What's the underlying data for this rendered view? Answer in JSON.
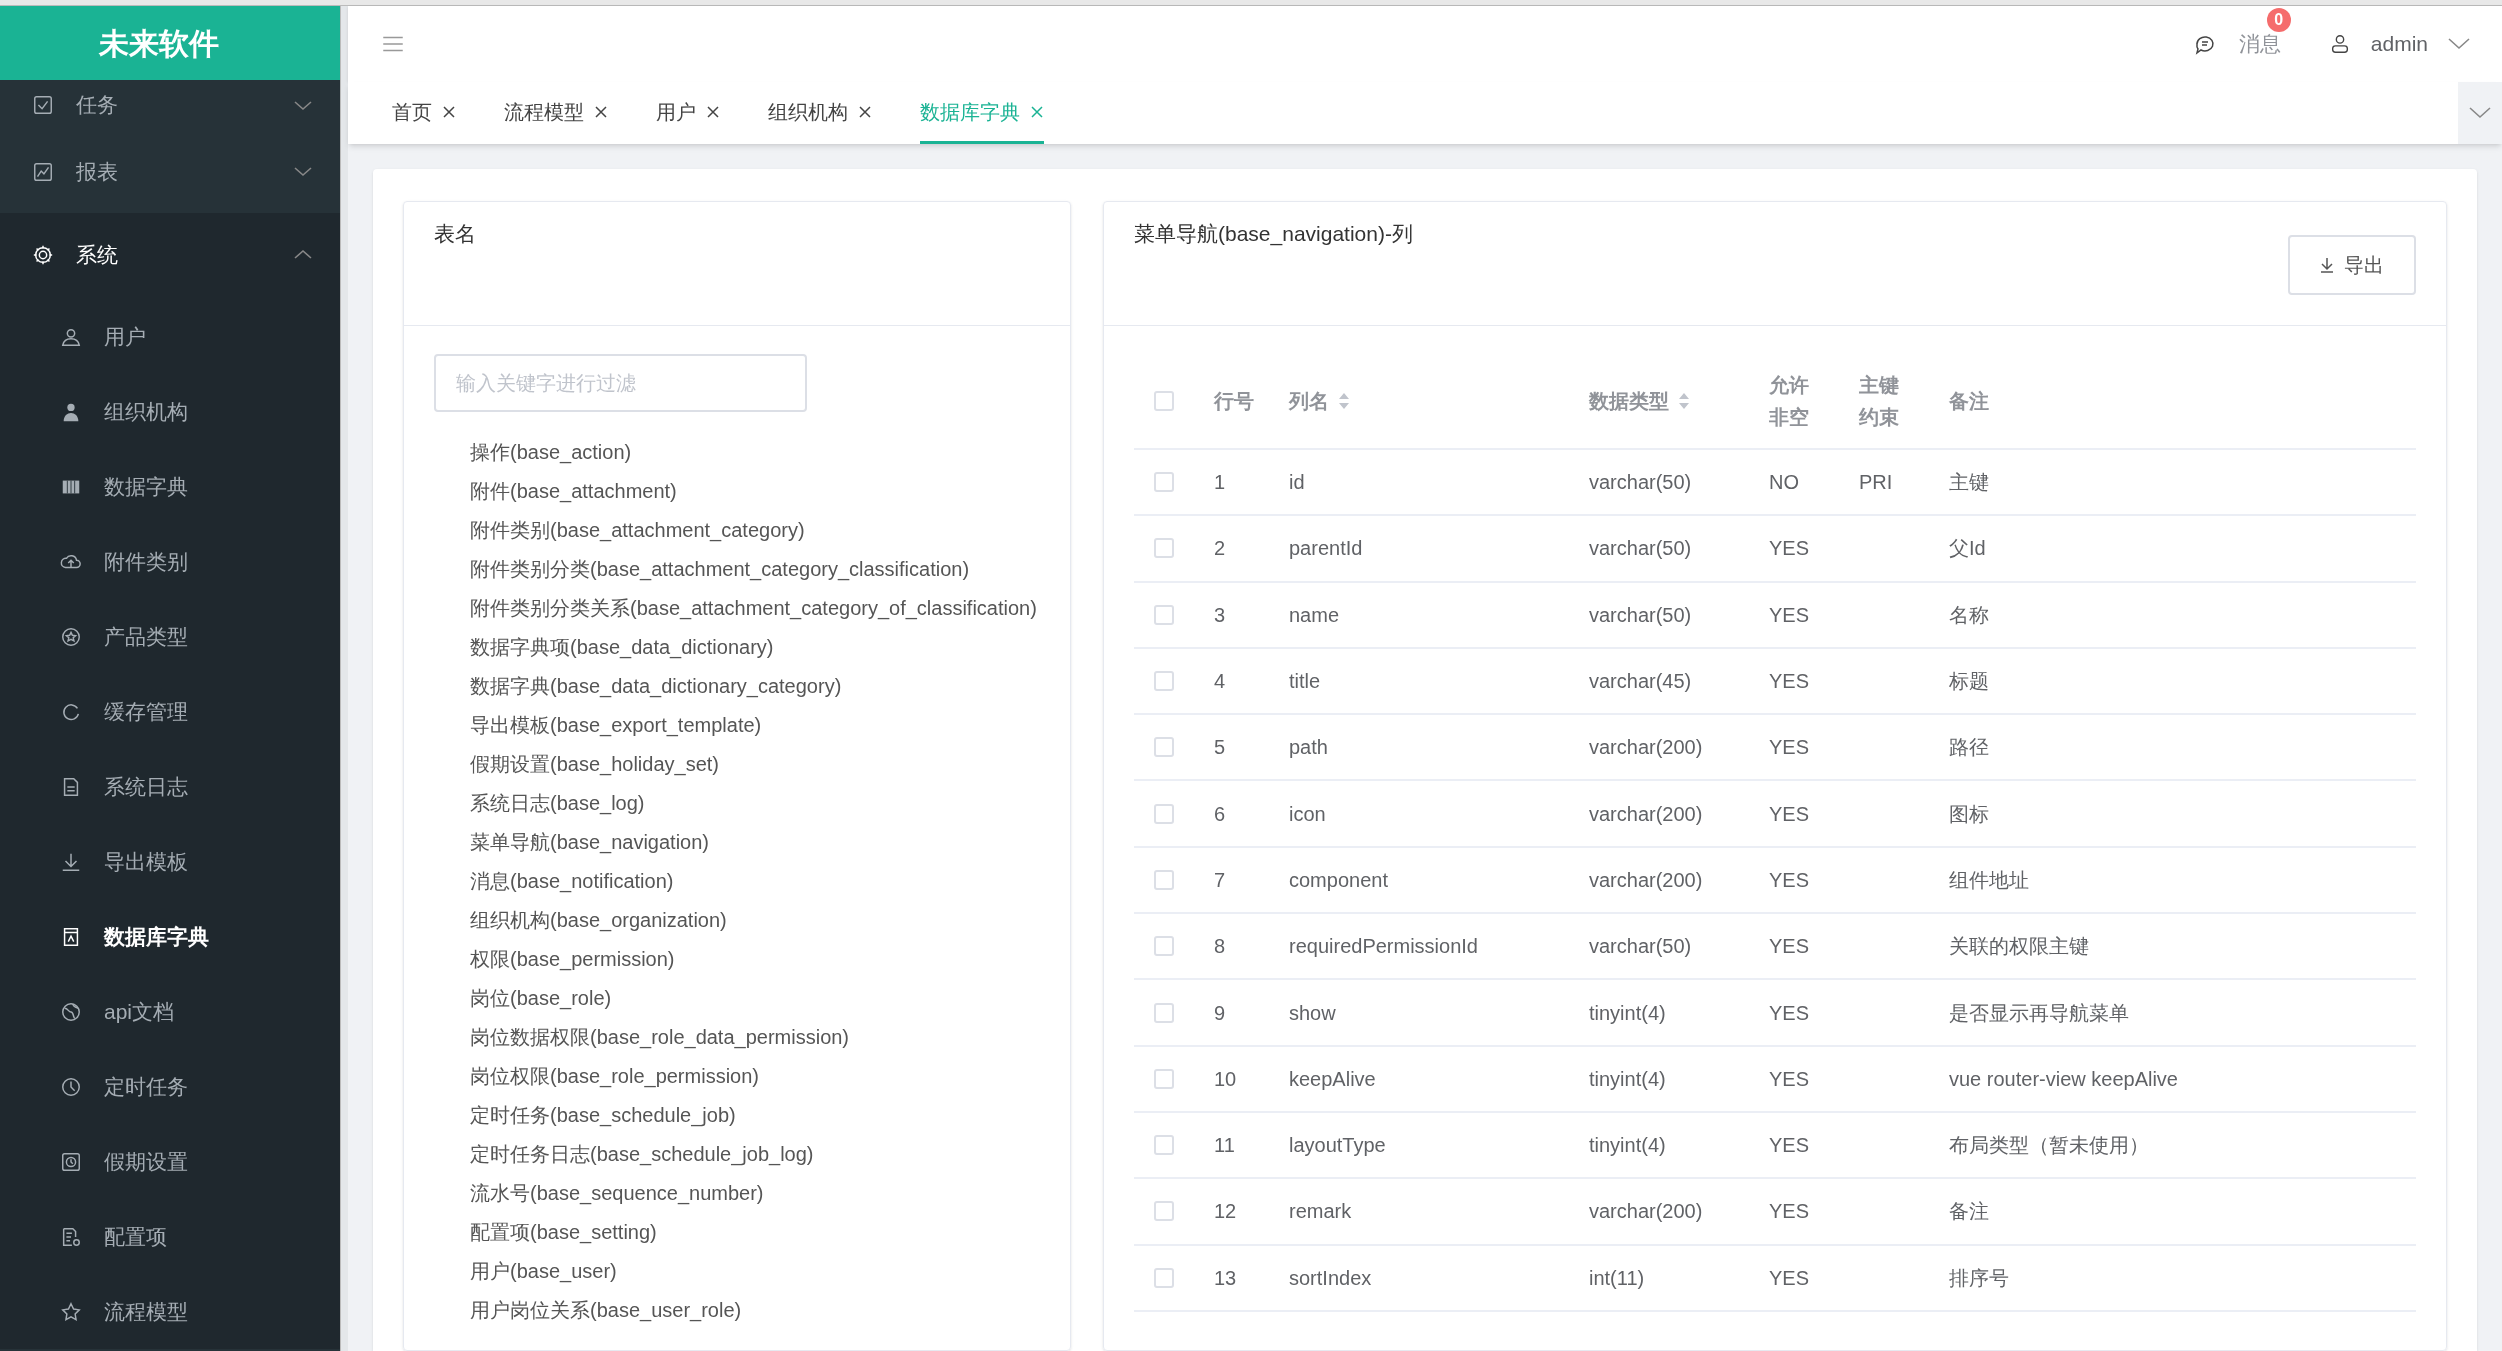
{
  "logo": "未来软件",
  "header": {
    "messages_label": "消息",
    "messages_count": "0",
    "user": "admin"
  },
  "sidebar": [
    {
      "kind": "group",
      "label": "任务",
      "expanded": false
    },
    {
      "kind": "group",
      "label": "报表",
      "expanded": false
    },
    {
      "kind": "group",
      "label": "系统",
      "expanded": true,
      "children": [
        {
          "label": "用户",
          "selected": false
        },
        {
          "label": "组织机构",
          "selected": false
        },
        {
          "label": "数据字典",
          "selected": false
        },
        {
          "label": "附件类别",
          "selected": false
        },
        {
          "label": "产品类型",
          "selected": false
        },
        {
          "label": "缓存管理",
          "selected": false
        },
        {
          "label": "系统日志",
          "selected": false
        },
        {
          "label": "导出模板",
          "selected": false
        },
        {
          "label": "数据库字典",
          "selected": true
        },
        {
          "label": "api文档",
          "selected": false
        },
        {
          "label": "定时任务",
          "selected": false
        },
        {
          "label": "假期设置",
          "selected": false
        },
        {
          "label": "配置项",
          "selected": false
        },
        {
          "label": "流程模型",
          "selected": false
        }
      ]
    }
  ],
  "tabs": [
    {
      "label": "首页",
      "selected": false
    },
    {
      "label": "流程模型",
      "selected": false
    },
    {
      "label": "用户",
      "selected": false
    },
    {
      "label": "组织机构",
      "selected": false
    },
    {
      "label": "数据库字典",
      "selected": true
    }
  ],
  "tables_panel": {
    "title": "表名",
    "filter": {
      "placeholder": "输入关键字进行过滤"
    },
    "tables": [
      "操作(base_action)",
      "附件(base_attachment)",
      "附件类别(base_attachment_category)",
      "附件类别分类(base_attachment_category_classification)",
      "附件类别分类关系(base_attachment_category_of_classification)",
      "数据字典项(base_data_dictionary)",
      "数据字典(base_data_dictionary_category)",
      "导出模板(base_export_template)",
      "假期设置(base_holiday_set)",
      "系统日志(base_log)",
      "菜单导航(base_navigation)",
      "消息(base_notification)",
      "组织机构(base_organization)",
      "权限(base_permission)",
      "岗位(base_role)",
      "岗位数据权限(base_role_data_permission)",
      "岗位权限(base_role_permission)",
      "定时任务(base_schedule_job)",
      "定时任务日志(base_schedule_job_log)",
      "流水号(base_sequence_number)",
      "配置项(base_setting)",
      "用户(base_user)",
      "用户岗位关系(base_user_role)"
    ]
  },
  "columns_panel": {
    "title": "菜单导航(base_navigation)-列",
    "export_button": "导出",
    "header_checked": false,
    "columns": [
      {
        "label": "行号",
        "sortable": false
      },
      {
        "label": "列名",
        "sortable": true
      },
      {
        "label": "数据类型",
        "sortable": true
      },
      {
        "label": "允许非空",
        "sortable": false
      },
      {
        "label": "主键约束",
        "sortable": false
      },
      {
        "label": "备注",
        "sortable": false
      }
    ],
    "rows": [
      {
        "checked": false,
        "cells": [
          "1",
          "id",
          "varchar(50)",
          "NO",
          "PRI",
          "主键"
        ]
      },
      {
        "checked": false,
        "cells": [
          "2",
          "parentId",
          "varchar(50)",
          "YES",
          "",
          "父Id"
        ]
      },
      {
        "checked": false,
        "cells": [
          "3",
          "name",
          "varchar(50)",
          "YES",
          "",
          "名称"
        ]
      },
      {
        "checked": false,
        "cells": [
          "4",
          "title",
          "varchar(45)",
          "YES",
          "",
          "标题"
        ]
      },
      {
        "checked": false,
        "cells": [
          "5",
          "path",
          "varchar(200)",
          "YES",
          "",
          "路径"
        ]
      },
      {
        "checked": false,
        "cells": [
          "6",
          "icon",
          "varchar(200)",
          "YES",
          "",
          "图标"
        ]
      },
      {
        "checked": false,
        "cells": [
          "7",
          "component",
          "varchar(200)",
          "YES",
          "",
          "组件地址"
        ]
      },
      {
        "checked": false,
        "cells": [
          "8",
          "requiredPermissionId",
          "varchar(50)",
          "YES",
          "",
          "关联的权限主键"
        ]
      },
      {
        "checked": false,
        "cells": [
          "9",
          "show",
          "tinyint(4)",
          "YES",
          "",
          "是否显示再导航菜单"
        ]
      },
      {
        "checked": false,
        "cells": [
          "10",
          "keepAlive",
          "tinyint(4)",
          "YES",
          "",
          "vue router-view keepAlive"
        ]
      },
      {
        "checked": false,
        "cells": [
          "11",
          "layoutType",
          "tinyint(4)",
          "YES",
          "",
          "布局类型（暂未使用）"
        ]
      },
      {
        "checked": false,
        "cells": [
          "12",
          "remark",
          "varchar(200)",
          "YES",
          "",
          "备注"
        ]
      },
      {
        "checked": false,
        "cells": [
          "13",
          "sortIndex",
          "int(11)",
          "YES",
          "",
          "排序号"
        ]
      }
    ]
  }
}
